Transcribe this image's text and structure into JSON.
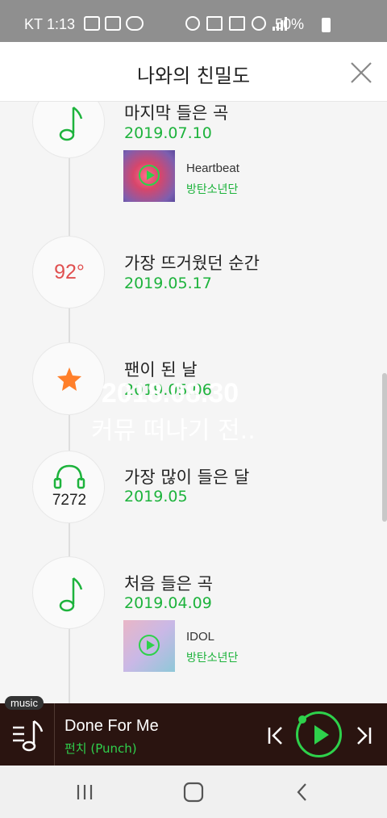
{
  "status_bar": {
    "carrier": "KT",
    "time": "1:13",
    "battery": "50%"
  },
  "header": {
    "title": "나와의 친밀도"
  },
  "timeline": {
    "last_song": {
      "title": "마지막 들은 곡",
      "date": "2019.07.10",
      "song": "Heartbeat",
      "artist": "방탄소년단"
    },
    "hottest": {
      "title": "가장 뜨거웠던 순간",
      "date": "2019.05.17",
      "temperature": "92°"
    },
    "became_fan": {
      "title": "팬이 된 날",
      "date": "2019.05.06"
    },
    "most_listened": {
      "title": "가장 많이 들은 달",
      "date": "2019.05",
      "count": "7272"
    },
    "first_song": {
      "title": "처음 들은 곡",
      "date": "2019.04.09",
      "song": "IDOL",
      "artist": "방탄소년단"
    }
  },
  "overlay": {
    "date": "2018.08.30",
    "text": "커뮤 떠나기 전.."
  },
  "player": {
    "tag": "music",
    "song": "Done For Me",
    "artist": "펀치 (Punch)"
  },
  "colors": {
    "accent_green": "#1db33c",
    "temperature_red": "#e05050",
    "star_orange": "#ff7f2a",
    "player_bg": "#2a1410"
  },
  "icons": [
    "music-note-icon",
    "star-icon",
    "headphones-icon",
    "close-icon",
    "play-icon",
    "prev-icon",
    "next-icon",
    "menu-icon"
  ]
}
